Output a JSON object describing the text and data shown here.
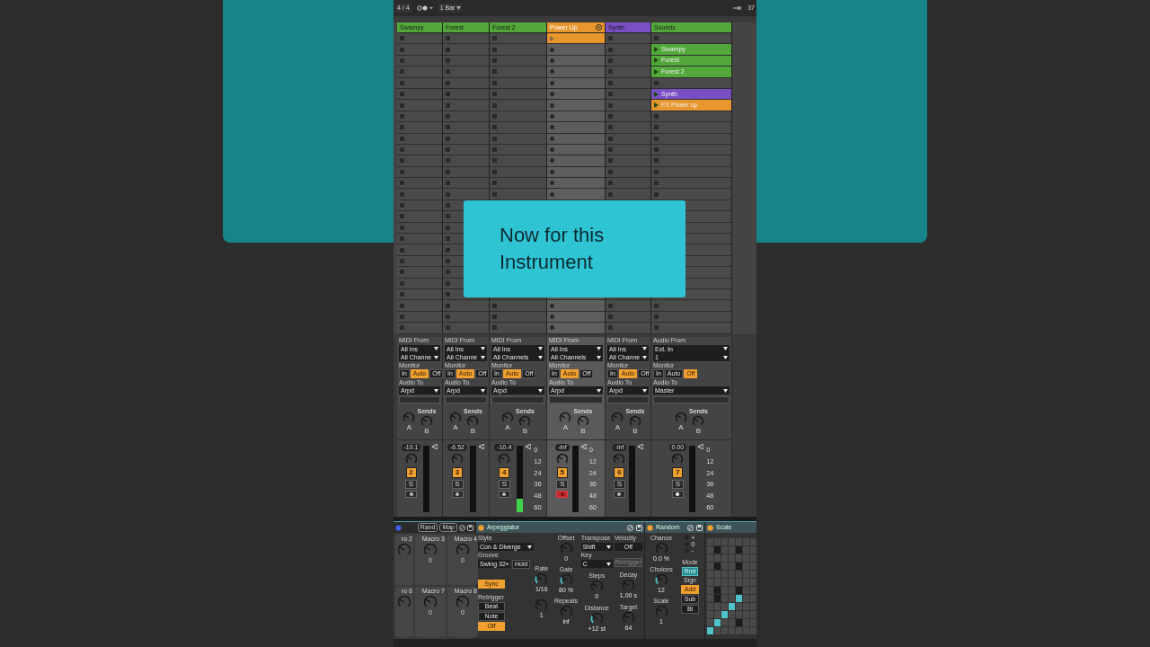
{
  "top_bar": {
    "time_signature": "4 / 4",
    "quantize": "1 Bar",
    "right_value": "37"
  },
  "tracks": [
    {
      "name": "Swampy",
      "color": "#52a83a",
      "kind": "midi",
      "selected": false,
      "io": {
        "from_label": "MIDI From",
        "from": "All Ins",
        "channel": "All Channe",
        "monitor_label": "Monitor",
        "monitor": [
          {
            "label": "In",
            "selected": false
          },
          {
            "label": "Auto",
            "selected": true
          },
          {
            "label": "Off",
            "selected": false
          }
        ],
        "to_label": "Audio To",
        "to": "Arpd"
      },
      "mixer": {
        "sends_label": "Sends",
        "sends": [
          "A",
          "B"
        ],
        "volume": "-10.1",
        "number": "2",
        "solo": "S",
        "armed": false
      }
    },
    {
      "name": "Forest",
      "color": "#52a83a",
      "kind": "midi",
      "selected": false,
      "io": {
        "from_label": "MIDI From",
        "from": "All Ins",
        "channel": "All Channe",
        "monitor_label": "Monitor",
        "monitor": [
          {
            "label": "In",
            "selected": false
          },
          {
            "label": "Auto",
            "selected": true
          },
          {
            "label": "Off",
            "selected": false
          }
        ],
        "to_label": "Audio To",
        "to": "Arpd"
      },
      "mixer": {
        "sends_label": "Sends",
        "sends": [
          "A",
          "B"
        ],
        "volume": "-6.52",
        "number": "3",
        "solo": "S",
        "armed": false
      }
    },
    {
      "name": "Forest 2",
      "color": "#52a83a",
      "kind": "midi",
      "selected": false,
      "io": {
        "from_label": "MIDI From",
        "from": "All Ins",
        "channel": "All Channels",
        "monitor_label": "Monitor",
        "monitor": [
          {
            "label": "In",
            "selected": false
          },
          {
            "label": "Auto",
            "selected": true
          },
          {
            "label": "Off",
            "selected": false
          }
        ],
        "to_label": "Audio To",
        "to": "Arpd"
      },
      "mixer": {
        "sends_label": "Sends",
        "sends": [
          "A",
          "B"
        ],
        "volume": "-10.4",
        "number": "4",
        "solo": "S",
        "armed": false,
        "meter": {
          "level": 0.2
        },
        "scale": [
          "0",
          "12",
          "24",
          "36",
          "48",
          "60"
        ]
      }
    },
    {
      "name": "Power Up",
      "color": "#e8962e",
      "kind": "midi",
      "selected": true,
      "slots": [
        {
          "kind": "clip",
          "color": "#e8962e"
        }
      ],
      "io": {
        "from_label": "MIDI From",
        "from": "All Ins",
        "channel": "All Channels",
        "monitor_label": "Monitor",
        "monitor": [
          {
            "label": "In",
            "selected": false
          },
          {
            "label": "Auto",
            "selected": true
          },
          {
            "label": "Off",
            "selected": false
          }
        ],
        "to_label": "Audio To",
        "to": "Arpd"
      },
      "mixer": {
        "sends_label": "Sends",
        "sends": [
          "A",
          "B"
        ],
        "volume": "-inf",
        "number": "5",
        "solo": "S",
        "armed": true,
        "scale": [
          "0",
          "12",
          "24",
          "36",
          "48",
          "60"
        ]
      }
    },
    {
      "name": "Synth",
      "color": "#7a4fc4",
      "kind": "midi",
      "selected": false,
      "io": {
        "from_label": "MIDI From",
        "from": "All Ins",
        "channel": "All Channe",
        "monitor_label": "Monitor",
        "monitor": [
          {
            "label": "In",
            "selected": false
          },
          {
            "label": "Auto",
            "selected": true
          },
          {
            "label": "Off",
            "selected": false
          }
        ],
        "to_label": "Audio To",
        "to": "Arpd"
      },
      "mixer": {
        "sends_label": "Sends",
        "sends": [
          "A",
          "B"
        ],
        "volume": "-inf",
        "number": "6",
        "solo": "S",
        "armed": false
      }
    },
    {
      "name": "Sounds",
      "color": "#52a83a",
      "kind": "audio",
      "selected": false,
      "slots": [
        {
          "kind": "empty"
        },
        {
          "kind": "clip",
          "name": "Swampy",
          "color": "#52a83a"
        },
        {
          "kind": "clip",
          "name": "Forest",
          "color": "#52a83a"
        },
        {
          "kind": "clip",
          "name": "Forest 2",
          "color": "#52a83a"
        },
        {
          "kind": "empty"
        },
        {
          "kind": "clip",
          "name": "Synth",
          "color": "#7a4fc4"
        },
        {
          "kind": "clip",
          "name": "FX Power up",
          "color": "#e8962e"
        }
      ],
      "io": {
        "from_label": "Audio From",
        "from": "Ext. In",
        "channel": "1",
        "monitor_label": "Monitor",
        "monitor": [
          {
            "label": "In",
            "selected": false
          },
          {
            "label": "Auto",
            "selected": false
          },
          {
            "label": "Off",
            "selected": true
          }
        ],
        "to_label": "Audio To",
        "to": "Master"
      },
      "mixer": {
        "sends_label": "Sends",
        "sends": [
          "A",
          "B"
        ],
        "volume": "0.00",
        "number": "7",
        "solo": "S",
        "armed": false,
        "scale": [
          "0",
          "12",
          "24",
          "36",
          "48",
          "60"
        ]
      }
    }
  ],
  "caption": "Now for this Instrument",
  "devices": {
    "rack": {
      "buttons": [
        "Rand",
        "Map"
      ],
      "macros": [
        {
          "label": "ro 2"
        },
        {
          "label": "Macro 3",
          "value": "0"
        },
        {
          "label": "Macro 4",
          "value": "0"
        },
        {
          "label": "ro 6"
        },
        {
          "label": "Macro 7",
          "value": "0"
        },
        {
          "label": "Macro 8",
          "value": "0"
        }
      ]
    },
    "arpeggiator": {
      "title": "Arpeggiator",
      "on": true,
      "style_label": "Style",
      "style": "Con & Diverge",
      "groove_label": "Groove",
      "groove": "Swing 32",
      "hold": {
        "label": "Hold",
        "on": false
      },
      "sync": {
        "label": "Sync",
        "on": true
      },
      "retrigger_label": "Retrigger",
      "retrigger": [
        {
          "label": "Beat",
          "selected": false
        },
        {
          "label": "Note",
          "selected": false
        },
        {
          "label": "Off",
          "selected": true
        }
      ],
      "offset": {
        "label": "Offset",
        "value": "0",
        "highlight": false
      },
      "rate": {
        "label": "Rate",
        "value": "1/16",
        "highlight": true
      },
      "gate": {
        "label": "Gate",
        "value": "80 %",
        "highlight": true
      },
      "retrigger_knob": {
        "value": "1",
        "highlight": false
      },
      "repeats": {
        "label": "Repeats",
        "value": "inf",
        "highlight": false
      },
      "transpose_label": "Transpose",
      "transpose": "Shift",
      "key_label": "Key",
      "key": "C",
      "steps": {
        "label": "Steps",
        "value": "0",
        "highlight": false
      },
      "distance": {
        "label": "Distance",
        "value": "+12 st",
        "highlight": true
      },
      "velocity_label": "Velocity",
      "velocity": "Off",
      "velocity_retrigger": {
        "label": "Retrigger",
        "disabled": true
      },
      "decay": {
        "label": "Decay",
        "value": "1.00 s",
        "highlight": false
      },
      "target": {
        "label": "Target",
        "value": "64",
        "highlight": false
      }
    },
    "random": {
      "title": "Random",
      "on": true,
      "chance": {
        "label": "Chance",
        "value": "0.0 %",
        "highlight": false
      },
      "choices": {
        "label": "Choices",
        "value": "12",
        "highlight": true
      },
      "scale": {
        "label": "Scale",
        "value": "1",
        "highlight": false
      },
      "indicator": [
        "+",
        "0",
        "-"
      ],
      "mode_label": "Mode",
      "mode": {
        "label": "Rnd",
        "selected": true
      },
      "sign_label": "Sign",
      "sign": [
        {
          "label": "Add",
          "selected": true
        },
        {
          "label": "Sub",
          "selected": false
        },
        {
          "label": "Bi",
          "selected": false
        }
      ]
    },
    "scale": {
      "title": "Scale",
      "on": true
    }
  }
}
